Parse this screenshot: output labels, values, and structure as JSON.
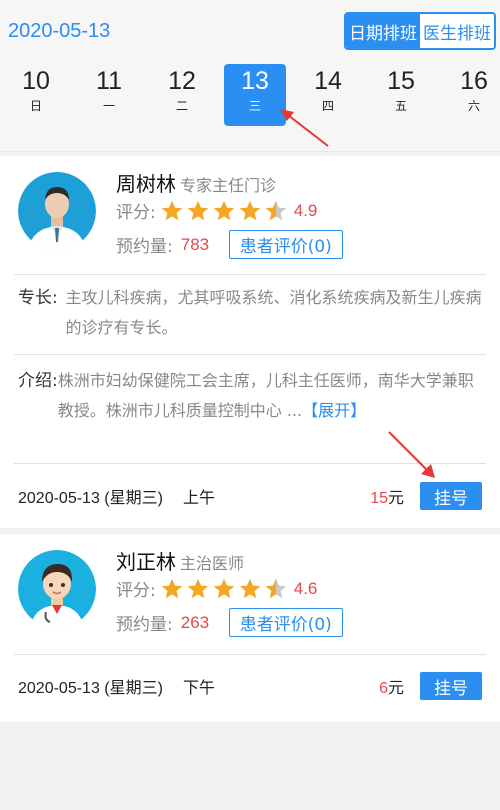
{
  "header": {
    "current_date": "2020-05-13",
    "tabs": [
      {
        "label": "日期排班",
        "active": true
      },
      {
        "label": "医生排班",
        "active": false
      }
    ]
  },
  "days": [
    {
      "num": "10",
      "weekday": "日",
      "selected": false
    },
    {
      "num": "11",
      "weekday": "一",
      "selected": false
    },
    {
      "num": "12",
      "weekday": "二",
      "selected": false
    },
    {
      "num": "13",
      "weekday": "三",
      "selected": true
    },
    {
      "num": "14",
      "weekday": "四",
      "selected": false
    },
    {
      "num": "15",
      "weekday": "五",
      "selected": false
    },
    {
      "num": "16",
      "weekday": "六",
      "selected": false
    }
  ],
  "labels": {
    "rating": "评分:",
    "appointments": "预约量:",
    "specialty": "专长:",
    "intro": "介绍:",
    "book": "挂号",
    "currency": "元"
  },
  "doctors": [
    {
      "name": "周树林",
      "title": "专家主任门诊",
      "rating": 4.9,
      "rating_text": "4.9",
      "appointments": "783",
      "review_label": "患者评价(0)",
      "specialty": "主攻儿科疾病，尤其呼吸系统、消化系统疾病及新生儿疾病的诊疗有专长。",
      "intro": "株洲市妇幼保健院工会主席，儿科主任医师，南华大学兼职教授。株洲市儿科质量控制中心 ...",
      "expand_label": "【展开】",
      "schedule": {
        "date": "2020-05-13 (星期三)",
        "period": "上午",
        "fee": "15"
      }
    },
    {
      "name": "刘正林",
      "title": "主治医师",
      "rating": 4.6,
      "rating_text": "4.6",
      "appointments": "263",
      "review_label": "患者评价(0)",
      "schedule": {
        "date": "2020-05-13 (星期三)",
        "period": "下午",
        "fee": "6"
      }
    }
  ],
  "colors": {
    "accent": "#2a8ff0",
    "star": "#f5a623",
    "highlight": "#e24b4b"
  }
}
